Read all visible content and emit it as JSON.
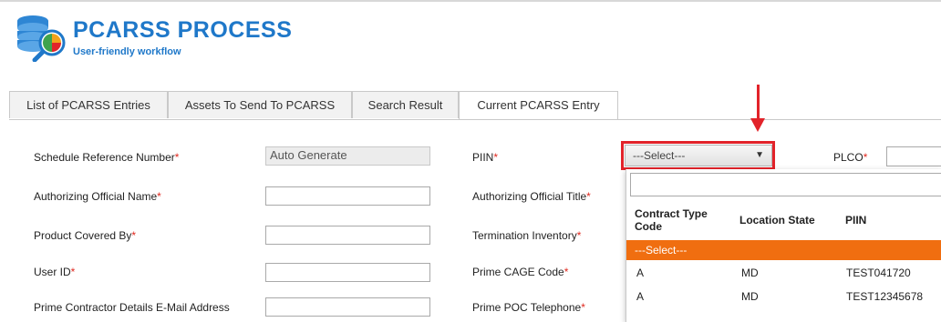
{
  "app": {
    "title": "PCARSS PROCESS",
    "subtitle": "User-friendly workflow"
  },
  "tabs": [
    {
      "label": "List of PCARSS Entries"
    },
    {
      "label": "Assets To Send To PCARSS"
    },
    {
      "label": "Search Result"
    },
    {
      "label": "Current PCARSS Entry",
      "active": true
    }
  ],
  "form": {
    "schedule_ref": {
      "label": "Schedule Reference Number",
      "value": "Auto Generate"
    },
    "auth_name": {
      "label": "Authorizing Official Name",
      "value": ""
    },
    "product_covered": {
      "label": "Product Covered By",
      "value": ""
    },
    "user_id": {
      "label": "User ID",
      "value": ""
    },
    "prime_email": {
      "label": "Prime Contractor Details E-Mail Address"
    },
    "piin": {
      "label": "PIIN",
      "selected": "---Select---"
    },
    "auth_title": {
      "label": "Authorizing Official Title"
    },
    "termination_inventory": {
      "label": "Termination Inventory"
    },
    "prime_cage": {
      "label": "Prime CAGE Code"
    },
    "prime_poc_tel": {
      "label": "Prime POC Telephone"
    },
    "plco": {
      "label": "PLCO",
      "value": ""
    },
    "required_mark": "*"
  },
  "piin_dropdown": {
    "search_value": "",
    "columns": [
      "Contract Type Code",
      "Location State",
      "PIIN"
    ],
    "option_select": "---Select---",
    "rows": [
      {
        "contract_type": "A",
        "state": "MD",
        "piin": "TEST041720"
      },
      {
        "contract_type": "A",
        "state": "MD",
        "piin": "TEST12345678"
      }
    ]
  },
  "colors": {
    "accent": "#1f78c9",
    "highlight": "#e2232a",
    "option_active": "#f06e10"
  },
  "icons": {
    "logo": "database-chart-search-icon",
    "caret": "caret-down-icon",
    "annotation": "red-arrow-icon"
  }
}
